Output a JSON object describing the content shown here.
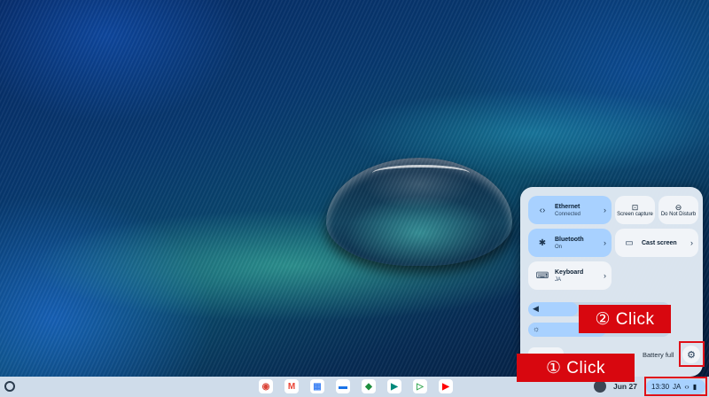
{
  "quick_settings": {
    "ethernet": {
      "label": "Ethernet",
      "status": "Connected",
      "icon": "ethernet-icon"
    },
    "bluetooth": {
      "label": "Bluetooth",
      "status": "On",
      "icon": "bluetooth-icon"
    },
    "keyboard": {
      "label": "Keyboard",
      "status": "JA",
      "icon": "keyboard-icon"
    },
    "screen_capture": {
      "label": "Screen capture",
      "icon": "screen-capture-icon"
    },
    "do_not_disturb": {
      "label": "Do Not Disturb",
      "icon": "do-not-disturb-icon"
    },
    "cast_screen": {
      "label": "Cast screen",
      "icon": "cast-icon"
    },
    "volume": {
      "icon": "volume-icon",
      "level": 0.35
    },
    "brightness": {
      "icon": "brightness-icon",
      "level": 0.55
    },
    "battery_label": "Battery full",
    "settings_icon": "gear-icon"
  },
  "callouts": {
    "step1": "① Click",
    "step2": "② Click"
  },
  "shelf": {
    "date": "Jun 27",
    "time": "13:30",
    "ime": "JA",
    "apps": [
      {
        "name": "chrome",
        "color": "#db4437"
      },
      {
        "name": "gmail",
        "color": "#ea4335"
      },
      {
        "name": "calendar",
        "color": "#4285f4"
      },
      {
        "name": "files",
        "color": "#1a73e8"
      },
      {
        "name": "chat",
        "color": "#1e8e3e"
      },
      {
        "name": "meet",
        "color": "#00897b"
      },
      {
        "name": "play-store",
        "color": "#34a853"
      },
      {
        "name": "youtube",
        "color": "#ff0000"
      }
    ]
  }
}
